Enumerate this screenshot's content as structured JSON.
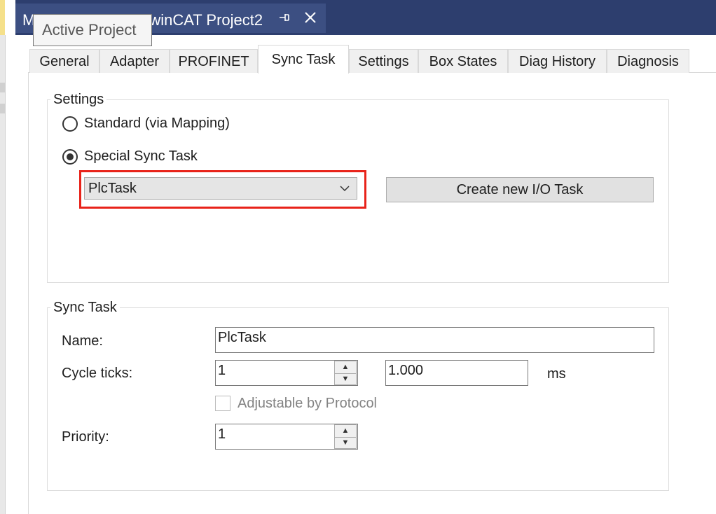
{
  "ide": {
    "doc_tab_title": "M",
    "doc_tab_title_rest": "winCAT Project2",
    "tooltip": "Active Project",
    "pin_icon": "pin-icon",
    "close_icon": "close-icon"
  },
  "tabs": [
    {
      "label": "General"
    },
    {
      "label": "Adapter"
    },
    {
      "label": "PROFINET"
    },
    {
      "label": "Sync Task",
      "active": true
    },
    {
      "label": "Settings"
    },
    {
      "label": "Box States"
    },
    {
      "label": "Diag History"
    },
    {
      "label": "Diagnosis"
    }
  ],
  "settings_group": {
    "title": "Settings",
    "radio_standard": "Standard (via Mapping)",
    "radio_special": "Special Sync Task",
    "selected": "Special Sync Task",
    "task_select_value": "PlcTask",
    "create_button": "Create new I/O Task"
  },
  "sync_task_group": {
    "title": "Sync Task",
    "name_label": "Name:",
    "name_value": "PlcTask",
    "cycle_label": "Cycle ticks:",
    "cycle_value": "1",
    "cycle_ms_value": "1.000",
    "unit": "ms",
    "adjustable_label": "Adjustable by Protocol",
    "adjustable_checked": false,
    "priority_label": "Priority:",
    "priority_value": "1"
  },
  "colors": {
    "doc_bar": "#2d3e6e",
    "highlight": "#e8231a"
  }
}
